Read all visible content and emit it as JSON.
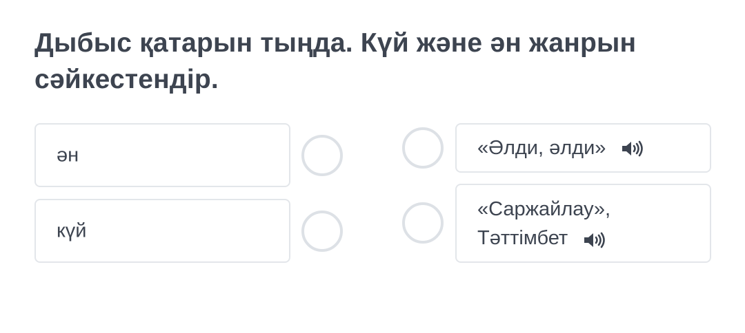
{
  "question": {
    "title": "Дыбыс қатарын тыңда. Күй және ән жанрын сәйкестендір."
  },
  "left_items": [
    {
      "label": "ән"
    },
    {
      "label": "күй"
    }
  ],
  "right_items": [
    {
      "line1": "«Әлди, әлди»",
      "line2": "",
      "icon": "speaker-icon"
    },
    {
      "line1": "«Саржайлау»,",
      "line2": "Тәттімбет",
      "icon": "speaker-icon"
    }
  ]
}
